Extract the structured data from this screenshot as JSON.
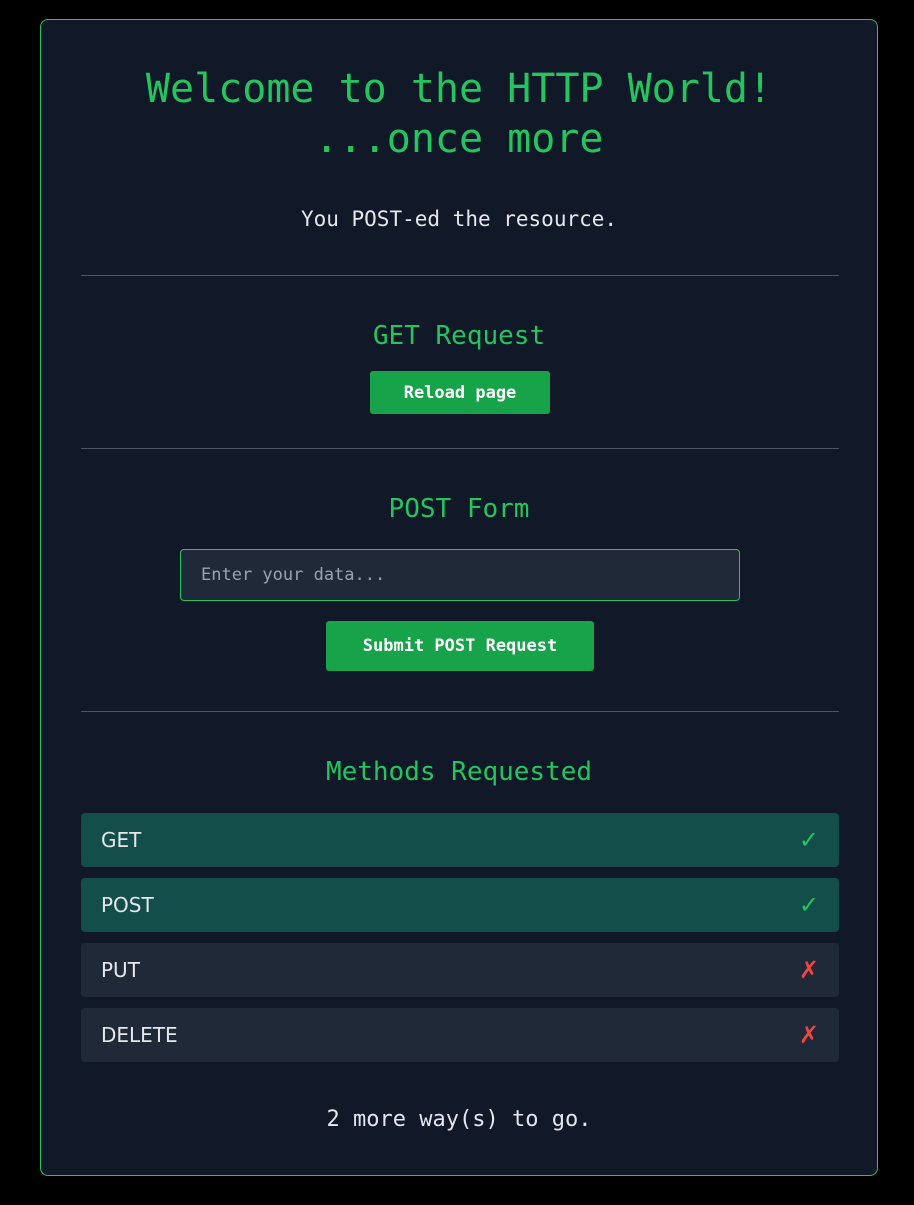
{
  "header": {
    "title_line1": "Welcome to the HTTP World!",
    "title_line2": "...once more",
    "status_message": "You POST-ed the resource."
  },
  "get_section": {
    "title": "GET Request",
    "button_label": "Reload page"
  },
  "post_section": {
    "title": "POST Form",
    "input_placeholder": "Enter your data...",
    "input_value": "",
    "button_label": "Submit POST Request"
  },
  "methods_section": {
    "title": "Methods Requested",
    "items": [
      {
        "label": "GET",
        "mark": "✓",
        "requested": true
      },
      {
        "label": "POST",
        "mark": "✓",
        "requested": true
      },
      {
        "label": "PUT",
        "mark": "✗",
        "requested": false
      },
      {
        "label": "DELETE",
        "mark": "✗",
        "requested": false
      }
    ]
  },
  "footer": {
    "message": "2 more way(s) to go."
  },
  "colors": {
    "background": "#000000",
    "card": "#111827",
    "accent": "#22c55e",
    "button": "#16a34a",
    "row_done": "#134e4a",
    "row_pending": "#1f2937",
    "success": "#22c55e",
    "failure": "#ef4444"
  },
  "icons": {
    "done": "check-icon",
    "pending": "cross-icon"
  }
}
